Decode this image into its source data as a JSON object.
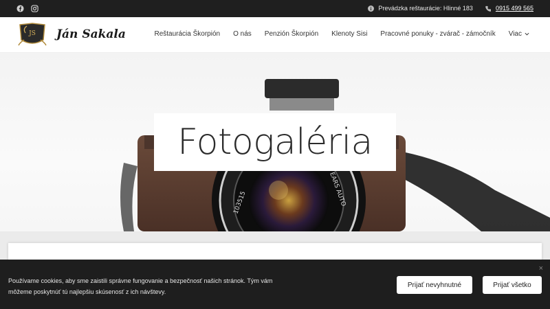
{
  "topbar": {
    "social": [
      "facebook-icon",
      "instagram-icon"
    ],
    "address": "Prevádzka reštaurácie: Hlinné 183",
    "phone": "0915 499 565"
  },
  "header": {
    "logo_text": "JS",
    "brand": "Ján Sakala",
    "nav": {
      "item1": "Reštaurácia Škorpión",
      "item2": "O nás",
      "item3": "Penzión Škorpión",
      "item4": "Klenoty Sisi",
      "item5": "Pracovné ponuky - zvárač - zámočník",
      "more": "Viac"
    }
  },
  "hero": {
    "title": "Fotogaléria",
    "lens_text_1": "103515",
    "lens_text_2": "EARS AUTO"
  },
  "cookie": {
    "text": "Používame cookies, aby sme zaistili správne fungovanie a bezpečnosť našich stránok. Tým vám môžeme poskytnúť tú najlepšiu skúsenosť z ich návštevy.",
    "btn_necessary": "Prijať nevyhnutné",
    "btn_all": "Prijať všetko",
    "close": "×"
  },
  "colors": {
    "topbar": "#1f1f1f",
    "cookie_bg": "#1e1e1e",
    "accent": "#ffffff"
  }
}
